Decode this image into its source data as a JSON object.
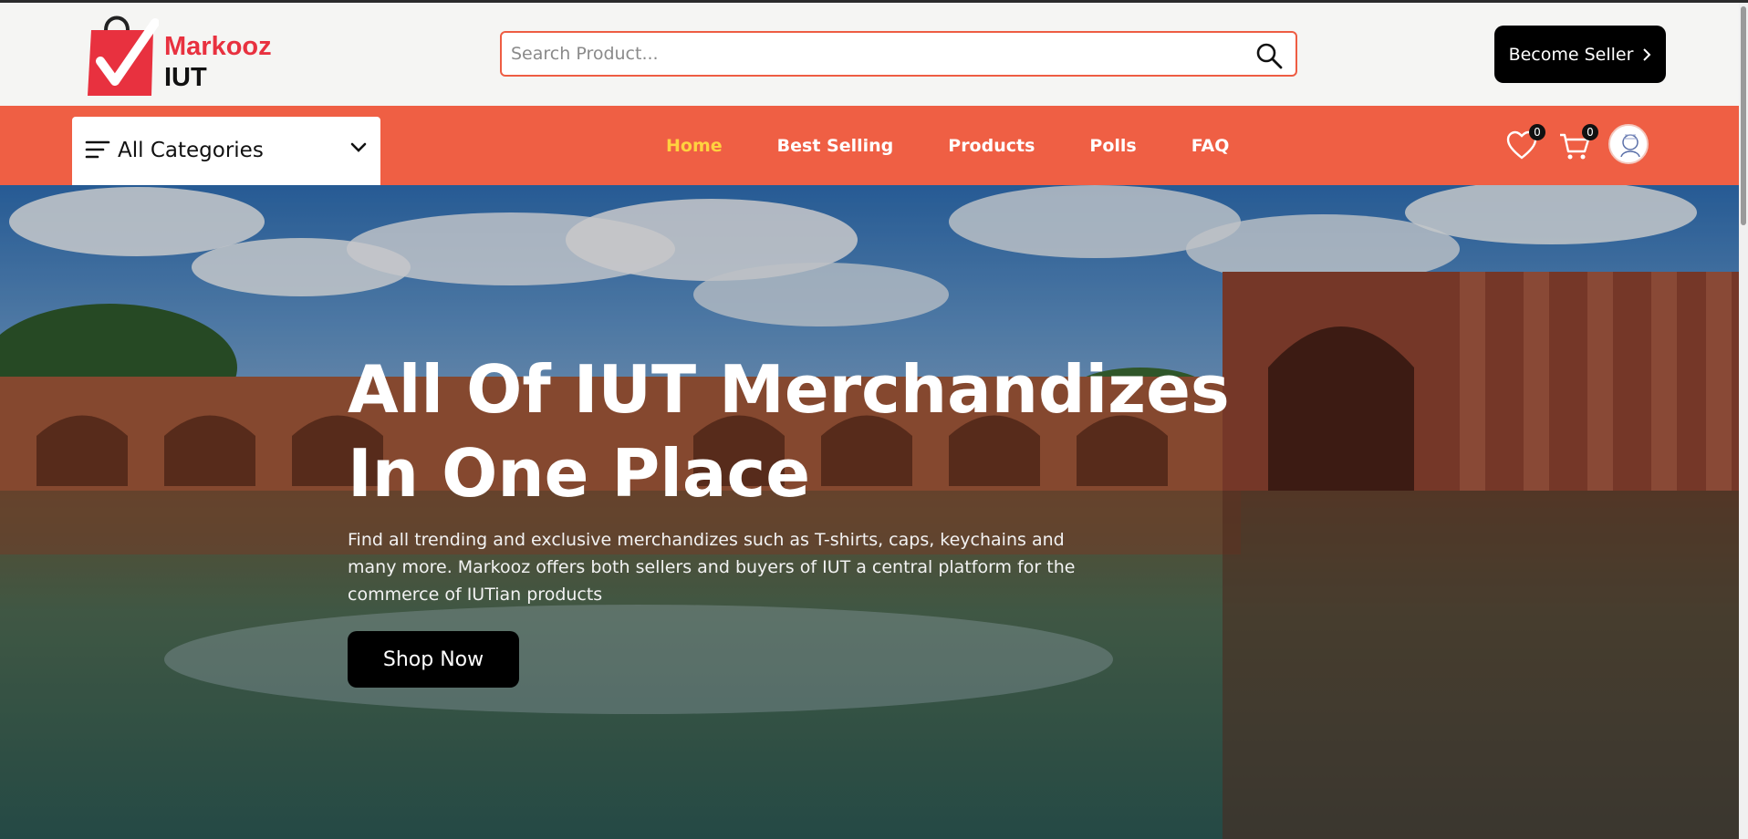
{
  "brand": {
    "line1": "Markooz",
    "line2": "IUT"
  },
  "search": {
    "placeholder": "Search Product..."
  },
  "header": {
    "seller_label": "Become Seller",
    "seller_icon": "chevron-right-icon"
  },
  "nav": {
    "categories_label": "All Categories",
    "links": [
      {
        "label": "Home",
        "active": true
      },
      {
        "label": "Best Selling"
      },
      {
        "label": "Products"
      },
      {
        "label": "Polls"
      },
      {
        "label": "FAQ"
      }
    ],
    "wishlist_count": "0",
    "cart_count": "0"
  },
  "hero": {
    "title_line1": "All Of IUT Merchandizes",
    "title_line2": "In One Place",
    "description": "Find all trending and exclusive merchandizes such as T-shirts, caps, keychains and many more. Markooz offers both sellers and buyers of IUT a central platform for the commerce of IUTian products",
    "cta_label": "Shop Now"
  },
  "colors": {
    "accent": "#ef5f44",
    "active_nav": "#ffd23f",
    "brand_red": "#e8313f"
  }
}
